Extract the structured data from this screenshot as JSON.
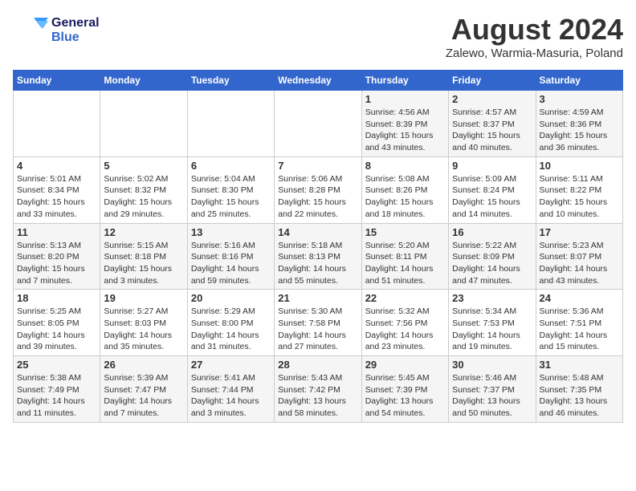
{
  "header": {
    "logo_line1": "General",
    "logo_line2": "Blue",
    "month_title": "August 2024",
    "location": "Zalewo, Warmia-Masuria, Poland"
  },
  "days_of_week": [
    "Sunday",
    "Monday",
    "Tuesday",
    "Wednesday",
    "Thursday",
    "Friday",
    "Saturday"
  ],
  "weeks": [
    {
      "id": "week1",
      "days": [
        {
          "num": "",
          "info": ""
        },
        {
          "num": "",
          "info": ""
        },
        {
          "num": "",
          "info": ""
        },
        {
          "num": "",
          "info": ""
        },
        {
          "num": "1",
          "info": "Sunrise: 4:56 AM\nSunset: 8:39 PM\nDaylight: 15 hours\nand 43 minutes."
        },
        {
          "num": "2",
          "info": "Sunrise: 4:57 AM\nSunset: 8:37 PM\nDaylight: 15 hours\nand 40 minutes."
        },
        {
          "num": "3",
          "info": "Sunrise: 4:59 AM\nSunset: 8:36 PM\nDaylight: 15 hours\nand 36 minutes."
        }
      ]
    },
    {
      "id": "week2",
      "days": [
        {
          "num": "4",
          "info": "Sunrise: 5:01 AM\nSunset: 8:34 PM\nDaylight: 15 hours\nand 33 minutes."
        },
        {
          "num": "5",
          "info": "Sunrise: 5:02 AM\nSunset: 8:32 PM\nDaylight: 15 hours\nand 29 minutes."
        },
        {
          "num": "6",
          "info": "Sunrise: 5:04 AM\nSunset: 8:30 PM\nDaylight: 15 hours\nand 25 minutes."
        },
        {
          "num": "7",
          "info": "Sunrise: 5:06 AM\nSunset: 8:28 PM\nDaylight: 15 hours\nand 22 minutes."
        },
        {
          "num": "8",
          "info": "Sunrise: 5:08 AM\nSunset: 8:26 PM\nDaylight: 15 hours\nand 18 minutes."
        },
        {
          "num": "9",
          "info": "Sunrise: 5:09 AM\nSunset: 8:24 PM\nDaylight: 15 hours\nand 14 minutes."
        },
        {
          "num": "10",
          "info": "Sunrise: 5:11 AM\nSunset: 8:22 PM\nDaylight: 15 hours\nand 10 minutes."
        }
      ]
    },
    {
      "id": "week3",
      "days": [
        {
          "num": "11",
          "info": "Sunrise: 5:13 AM\nSunset: 8:20 PM\nDaylight: 15 hours\nand 7 minutes."
        },
        {
          "num": "12",
          "info": "Sunrise: 5:15 AM\nSunset: 8:18 PM\nDaylight: 15 hours\nand 3 minutes."
        },
        {
          "num": "13",
          "info": "Sunrise: 5:16 AM\nSunset: 8:16 PM\nDaylight: 14 hours\nand 59 minutes."
        },
        {
          "num": "14",
          "info": "Sunrise: 5:18 AM\nSunset: 8:13 PM\nDaylight: 14 hours\nand 55 minutes."
        },
        {
          "num": "15",
          "info": "Sunrise: 5:20 AM\nSunset: 8:11 PM\nDaylight: 14 hours\nand 51 minutes."
        },
        {
          "num": "16",
          "info": "Sunrise: 5:22 AM\nSunset: 8:09 PM\nDaylight: 14 hours\nand 47 minutes."
        },
        {
          "num": "17",
          "info": "Sunrise: 5:23 AM\nSunset: 8:07 PM\nDaylight: 14 hours\nand 43 minutes."
        }
      ]
    },
    {
      "id": "week4",
      "days": [
        {
          "num": "18",
          "info": "Sunrise: 5:25 AM\nSunset: 8:05 PM\nDaylight: 14 hours\nand 39 minutes."
        },
        {
          "num": "19",
          "info": "Sunrise: 5:27 AM\nSunset: 8:03 PM\nDaylight: 14 hours\nand 35 minutes."
        },
        {
          "num": "20",
          "info": "Sunrise: 5:29 AM\nSunset: 8:00 PM\nDaylight: 14 hours\nand 31 minutes."
        },
        {
          "num": "21",
          "info": "Sunrise: 5:30 AM\nSunset: 7:58 PM\nDaylight: 14 hours\nand 27 minutes."
        },
        {
          "num": "22",
          "info": "Sunrise: 5:32 AM\nSunset: 7:56 PM\nDaylight: 14 hours\nand 23 minutes."
        },
        {
          "num": "23",
          "info": "Sunrise: 5:34 AM\nSunset: 7:53 PM\nDaylight: 14 hours\nand 19 minutes."
        },
        {
          "num": "24",
          "info": "Sunrise: 5:36 AM\nSunset: 7:51 PM\nDaylight: 14 hours\nand 15 minutes."
        }
      ]
    },
    {
      "id": "week5",
      "days": [
        {
          "num": "25",
          "info": "Sunrise: 5:38 AM\nSunset: 7:49 PM\nDaylight: 14 hours\nand 11 minutes."
        },
        {
          "num": "26",
          "info": "Sunrise: 5:39 AM\nSunset: 7:47 PM\nDaylight: 14 hours\nand 7 minutes."
        },
        {
          "num": "27",
          "info": "Sunrise: 5:41 AM\nSunset: 7:44 PM\nDaylight: 14 hours\nand 3 minutes."
        },
        {
          "num": "28",
          "info": "Sunrise: 5:43 AM\nSunset: 7:42 PM\nDaylight: 13 hours\nand 58 minutes."
        },
        {
          "num": "29",
          "info": "Sunrise: 5:45 AM\nSunset: 7:39 PM\nDaylight: 13 hours\nand 54 minutes."
        },
        {
          "num": "30",
          "info": "Sunrise: 5:46 AM\nSunset: 7:37 PM\nDaylight: 13 hours\nand 50 minutes."
        },
        {
          "num": "31",
          "info": "Sunrise: 5:48 AM\nSunset: 7:35 PM\nDaylight: 13 hours\nand 46 minutes."
        }
      ]
    }
  ]
}
